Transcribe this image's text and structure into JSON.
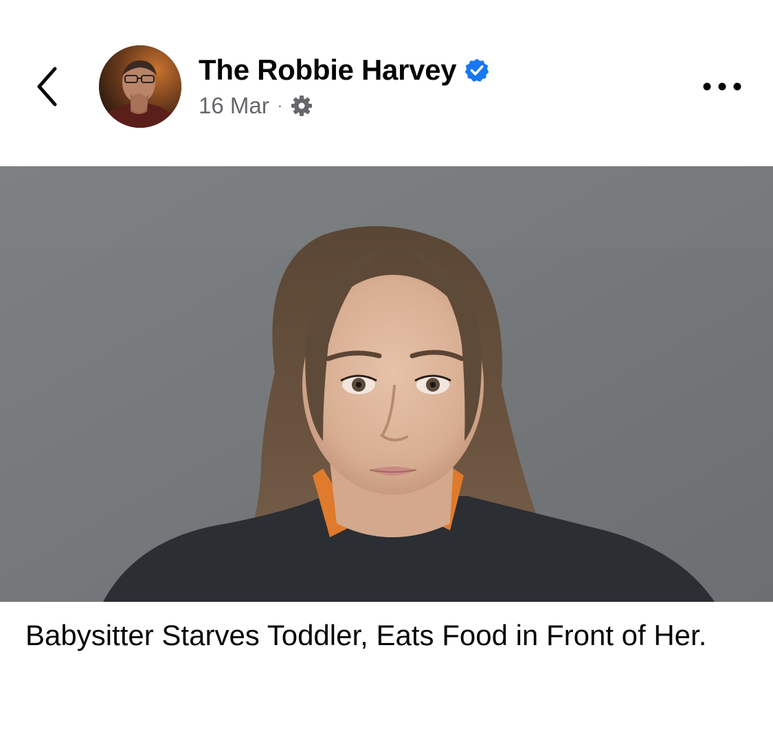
{
  "post": {
    "author": {
      "name": "The Robbie Harvey",
      "verified": true,
      "avatar_icon": "profile-photo"
    },
    "timestamp": "16 Mar",
    "separator": "·",
    "audience_icon": "gear-icon",
    "caption": "Babysitter Starves Toddler, Eats Food in Front of Her.",
    "photo": "mugshot-photo"
  },
  "icons": {
    "back": "chevron-left-icon",
    "more": "more-options-icon",
    "verified": "verified-badge-icon"
  },
  "colors": {
    "verified_blue": "#1877f2",
    "text_primary": "#050505",
    "text_secondary": "#65676b",
    "background": "#ffffff"
  }
}
